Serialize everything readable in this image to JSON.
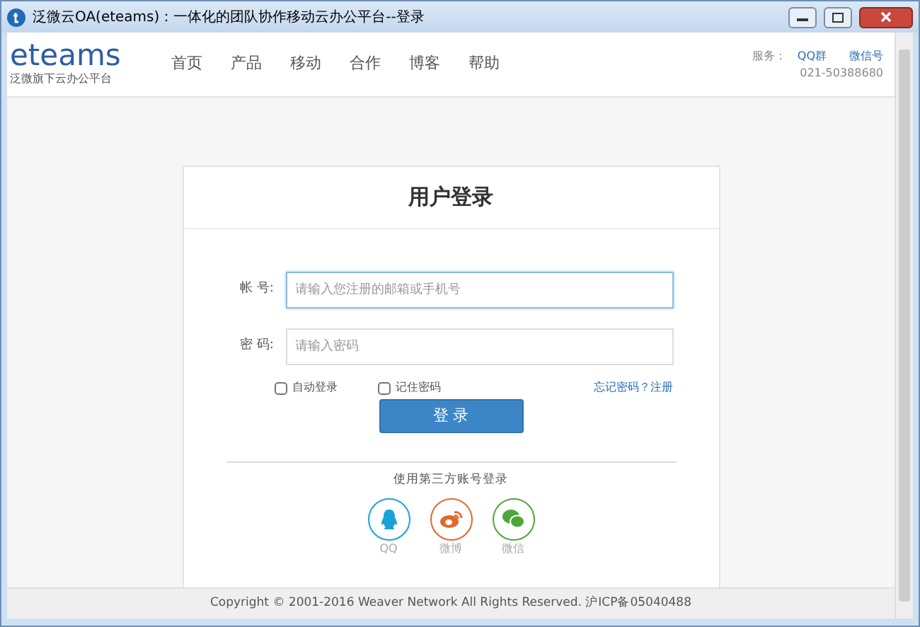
{
  "window": {
    "title": "泛微云OA(eteams)：一体化的团队协作移动云办公平台--登录"
  },
  "header": {
    "logo": "eteams",
    "tagline": "泛微旗下云办公平台",
    "nav": [
      "首页",
      "产品",
      "移动",
      "合作",
      "博客",
      "帮助"
    ],
    "service_label": "服务：",
    "service_links": [
      "QQ群",
      "微信号"
    ],
    "phone": "021-50388680"
  },
  "login": {
    "title": "用户登录",
    "fields": [
      {
        "label": "帐 号:",
        "placeholder": "请输入您注册的邮箱或手机号",
        "focused": true
      },
      {
        "label": "密 码:",
        "placeholder": "请输入密码",
        "focused": false
      }
    ],
    "options": [
      {
        "label": "自动登录",
        "checked": false
      },
      {
        "label": "记住密码",
        "checked": false
      }
    ],
    "forgot_link": "忘记密码？注册",
    "submit": "登 录",
    "third_party_title": "使用第三方账号登录",
    "third_party": [
      {
        "kind": "qq",
        "label": "QQ",
        "color": "#1aa2d8"
      },
      {
        "kind": "weibo",
        "label": "微博",
        "color": "#e2682a"
      },
      {
        "kind": "wechat",
        "label": "微信",
        "color": "#4ea63a"
      }
    ]
  },
  "footer": "Copyright © 2001-2016 Weaver Network All Rights Reserved. 沪ICP备05040488"
}
